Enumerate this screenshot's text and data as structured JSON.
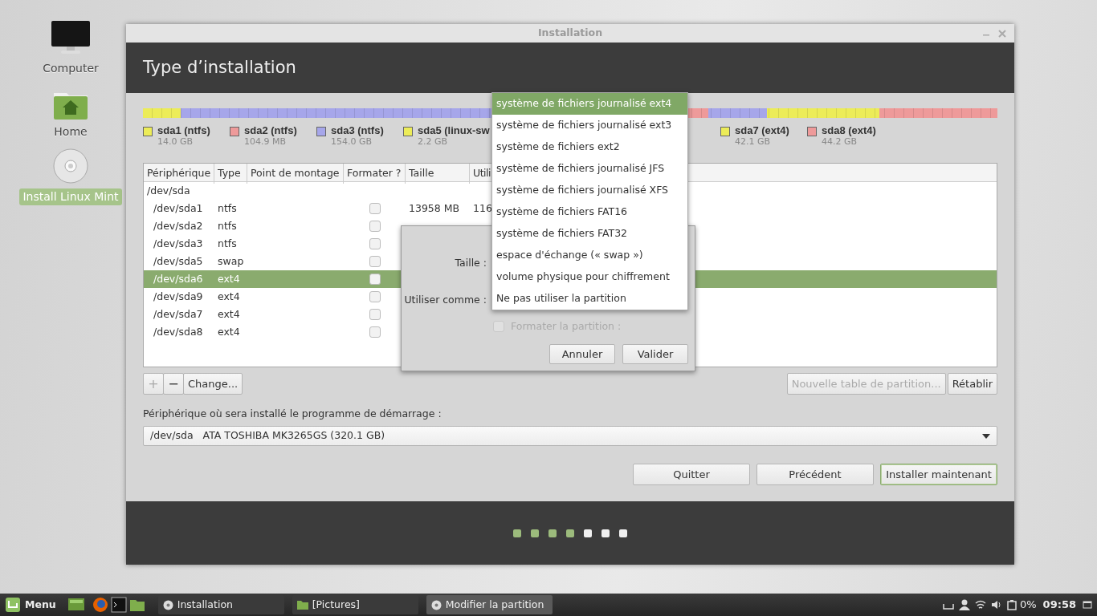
{
  "desktop_icons": [
    {
      "label": "Computer",
      "kind": "monitor",
      "selected": false
    },
    {
      "label": "Home",
      "kind": "home",
      "selected": false
    },
    {
      "label": "Install Linux Mint",
      "kind": "disc",
      "selected": true
    }
  ],
  "window": {
    "title": "Installation",
    "heading": "Type d’installation"
  },
  "legend": [
    {
      "name": "sda1 (ntfs)",
      "size": "14.0 GB",
      "color": "#ecec58"
    },
    {
      "name": "sda2 (ntfs)",
      "size": "104.9 MB",
      "color": "#ee9a9a"
    },
    {
      "name": "sda3 (ntfs)",
      "size": "154.0 GB",
      "color": "#a6a6ea"
    },
    {
      "name": "sda5 (linux-sw",
      "size": "2.2 GB",
      "color": "#ecec58"
    },
    {
      "name": "sda7 (ext4)",
      "size": "42.1 GB",
      "color": "#ecec58"
    },
    {
      "name": "sda8 (ext4)",
      "size": "44.2 GB",
      "color": "#ee9a9a"
    }
  ],
  "table": {
    "columns": [
      "Périphérique",
      "Type",
      "Point de montage",
      "Formater ?",
      "Taille",
      "Utili"
    ],
    "rows": [
      {
        "device": "/dev/sda",
        "selected": false,
        "children": [
          {
            "device": "/dev/sda1",
            "type": "ntfs",
            "format": false,
            "size": "13958 MB",
            "used": "116",
            "selected": false
          },
          {
            "device": "/dev/sda2",
            "type": "ntfs",
            "format": false,
            "selected": false
          },
          {
            "device": "/dev/sda3",
            "type": "ntfs",
            "format": false,
            "selected": false
          },
          {
            "device": "/dev/sda5",
            "type": "swap",
            "format": false,
            "selected": false
          },
          {
            "device": "/dev/sda6",
            "type": "ext4",
            "format": false,
            "selected": true
          },
          {
            "device": "/dev/sda9",
            "type": "ext4",
            "format": false,
            "selected": false
          },
          {
            "device": "/dev/sda7",
            "type": "ext4",
            "format": false,
            "selected": false
          },
          {
            "device": "/dev/sda8",
            "type": "ext4",
            "format": false,
            "selected": false
          }
        ]
      }
    ]
  },
  "toolbar": {
    "left": [
      {
        "label": "+",
        "disabled": true
      },
      {
        "label": "−",
        "disabled": false
      },
      {
        "label": "Change...",
        "disabled": false
      }
    ],
    "right": [
      {
        "label": "Nouvelle table de partition...",
        "disabled": true
      },
      {
        "label": "Rétablir",
        "disabled": false
      }
    ]
  },
  "boot_device": {
    "label": "Périphérique où sera installé le programme de démarrage :",
    "device": "/dev/sda",
    "description": "ATA TOSHIBA MK3265GS (320.1 GB)"
  },
  "actions": [
    {
      "label": "Quitter",
      "default": false
    },
    {
      "label": "Précédent",
      "default": false
    },
    {
      "label": "Installer maintenant",
      "default": true
    }
  ],
  "progress_steps": [
    {
      "done": true
    },
    {
      "done": true
    },
    {
      "done": true
    },
    {
      "done": true
    },
    {
      "done": false
    },
    {
      "done": false
    },
    {
      "done": false
    }
  ],
  "dialog": {
    "fields": [
      {
        "label": "Taille :"
      },
      {
        "label": "Utiliser comme :"
      }
    ],
    "format_checkbox": {
      "label": "Formater la partition :",
      "checked": false,
      "disabled": true
    },
    "buttons": [
      "Annuler",
      "Valider"
    ]
  },
  "dropdown": {
    "items": [
      {
        "label": "système de fichiers journalisé ext4",
        "selected": true
      },
      {
        "label": "système de fichiers journalisé ext3",
        "selected": false
      },
      {
        "label": "système de fichiers ext2",
        "selected": false
      },
      {
        "label": "système de fichiers journalisé JFS",
        "selected": false
      },
      {
        "label": "système de fichiers journalisé XFS",
        "selected": false
      },
      {
        "label": "système de fichiers FAT16",
        "selected": false
      },
      {
        "label": "système de fichiers FAT32",
        "selected": false
      },
      {
        "label": "espace d'échange (« swap »)",
        "selected": false
      },
      {
        "label": "volume physique pour chiffrement",
        "selected": false
      },
      {
        "label": "Ne pas utiliser la partition",
        "selected": false
      }
    ]
  },
  "taskbar": {
    "menu": "Menu",
    "launchers": [
      {
        "kind": "files"
      },
      {
        "kind": "browser"
      },
      {
        "kind": "terminal"
      },
      {
        "kind": "folder"
      }
    ],
    "tasks": [
      {
        "label": "Installation",
        "kind": "disc",
        "selected": false
      },
      {
        "label": "[Pictures]",
        "kind": "folder",
        "selected": false
      },
      {
        "label": "Modifier la partition",
        "kind": "disc",
        "selected": true
      }
    ],
    "battery": "0%",
    "clock": "09:58"
  }
}
